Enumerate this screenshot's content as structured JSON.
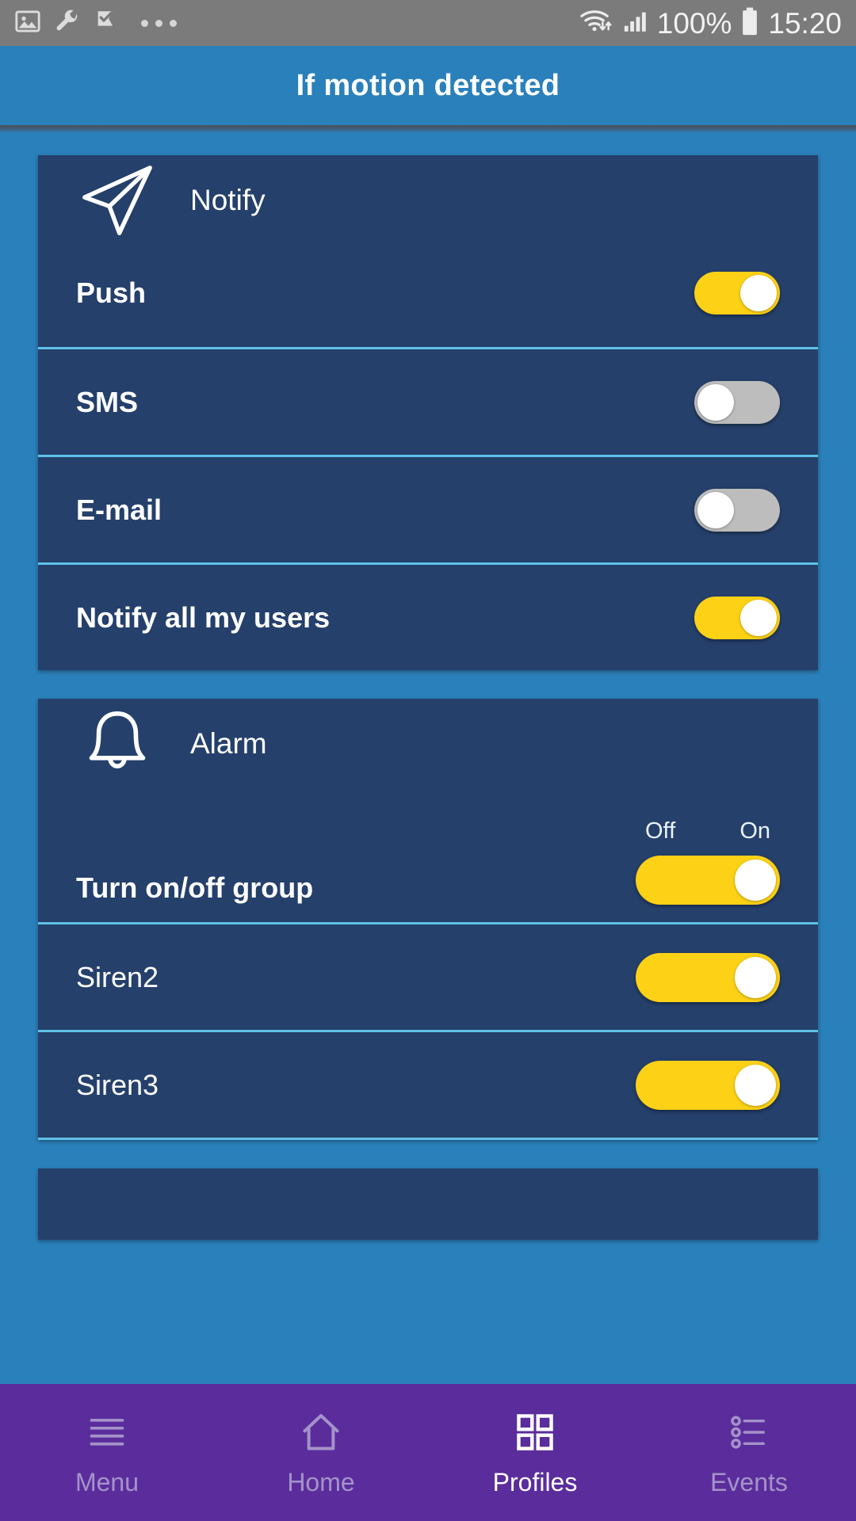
{
  "status_bar": {
    "left_icons": [
      "image-icon",
      "wrench-icon",
      "check-flag-icon",
      "overflow-dots-icon"
    ],
    "right_icons": [
      "wifi-icon",
      "signal-icon",
      "battery-icon"
    ],
    "battery_percent": "100%",
    "time": "15:20"
  },
  "app_bar": {
    "title": "If motion detected"
  },
  "cards": [
    {
      "id": "notify",
      "icon": "paper-plane-icon",
      "title": "Notify",
      "rows": [
        {
          "label": "Push",
          "bold": true,
          "toggle": "on",
          "wide": false,
          "scale": null
        },
        {
          "label": "SMS",
          "bold": true,
          "toggle": "off",
          "wide": false,
          "scale": null
        },
        {
          "label": "E-mail",
          "bold": true,
          "toggle": "off",
          "wide": false,
          "scale": null
        },
        {
          "label": "Notify all my users",
          "bold": true,
          "toggle": "on",
          "wide": false,
          "scale": null
        }
      ]
    },
    {
      "id": "alarm",
      "icon": "bell-icon",
      "title": "Alarm",
      "rows": [
        {
          "label": "Turn on/off group",
          "bold": true,
          "toggle": "on",
          "wide": true,
          "scale": {
            "off": "Off",
            "on": "On"
          }
        },
        {
          "label": "Siren2",
          "bold": false,
          "toggle": "on",
          "wide": true,
          "scale": null
        },
        {
          "label": "Siren3",
          "bold": false,
          "toggle": "on",
          "wide": true,
          "scale": null
        }
      ]
    }
  ],
  "bottom_nav": {
    "items": [
      {
        "label": "Menu",
        "icon": "hamburger-menu-icon",
        "active": false
      },
      {
        "label": "Home",
        "icon": "home-icon",
        "active": false
      },
      {
        "label": "Profiles",
        "icon": "grid-squares-icon",
        "active": true
      },
      {
        "label": "Events",
        "icon": "bulleted-list-icon",
        "active": false
      }
    ]
  },
  "colors": {
    "app_bar": "#2a80ba",
    "page_background": "#2a80ba",
    "card": "#25406b",
    "divider": "#5fc2e8",
    "toggle_on": "#fcd116",
    "toggle_off": "#bdbdbd",
    "nav_bar": "#5b2d9c",
    "status_bar": "#7b7b7b"
  }
}
